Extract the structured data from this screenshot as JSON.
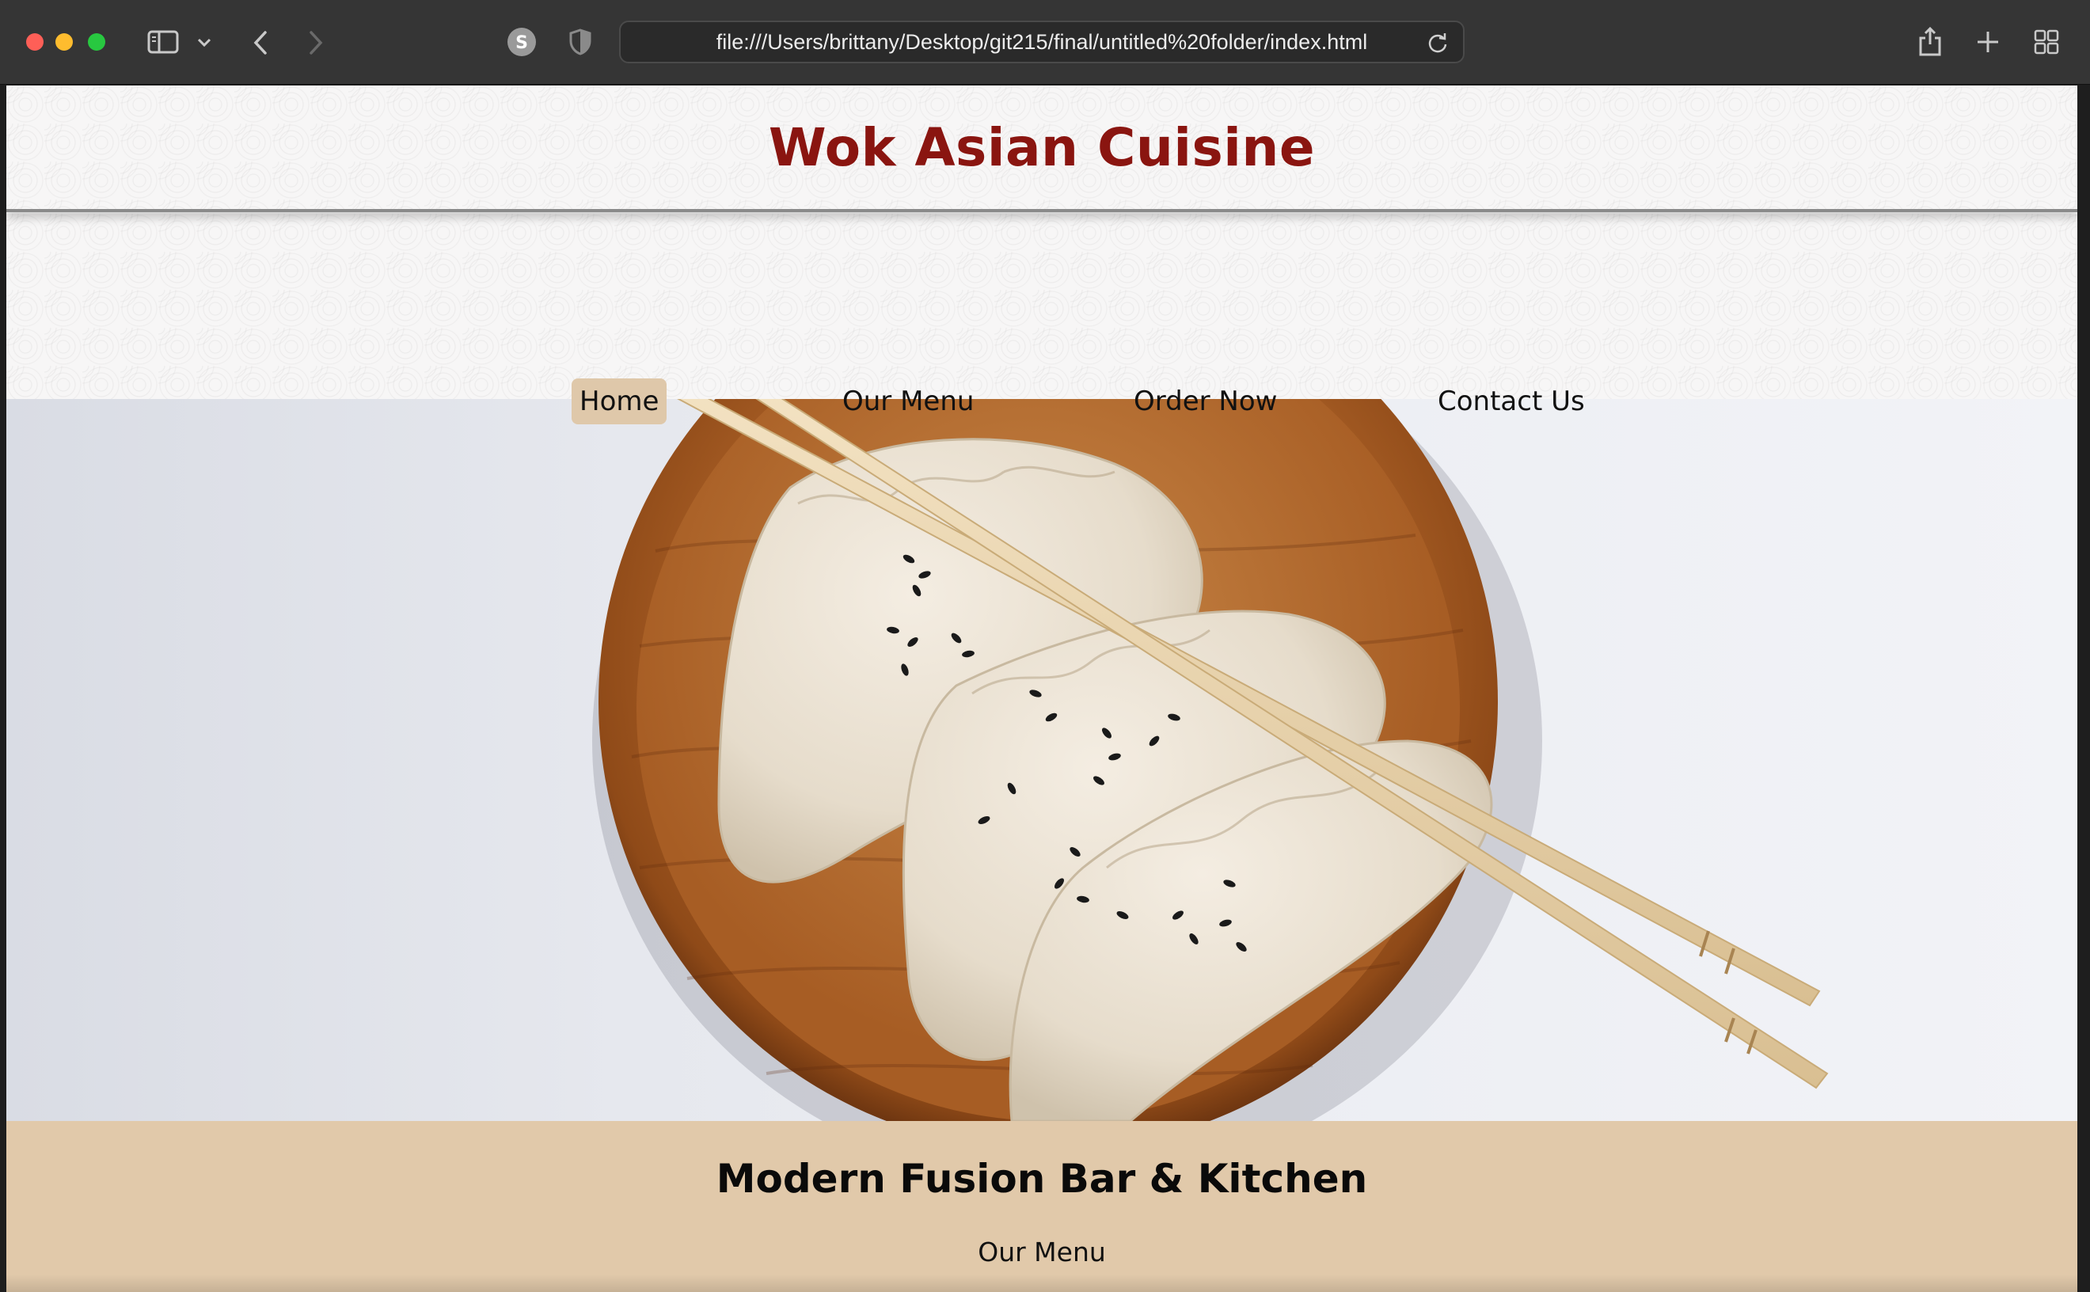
{
  "browser": {
    "url": "file:///Users/brittany/Desktop/git215/final/untitled%20folder/index.html",
    "icons": {
      "sidebar": "sidebar-icon",
      "dropdown": "chevron-down-icon",
      "back": "chevron-left-icon",
      "forward": "chevron-right-icon",
      "extension": "s-extension-icon",
      "privacy": "shield-icon",
      "reload": "reload-icon",
      "share": "share-icon",
      "new_tab": "plus-icon",
      "tab_overview": "grid-icon"
    }
  },
  "site": {
    "title": "Wok Asian Cuisine",
    "title_color": "#8a1510",
    "nav": [
      {
        "label": "Home",
        "active": true
      },
      {
        "label": "Our Menu",
        "active": false
      },
      {
        "label": "Order Now",
        "active": false
      },
      {
        "label": "Contact Us",
        "active": false
      }
    ],
    "hero_image": "dumplings-on-wooden-plate-with-chopsticks",
    "tagline": "Modern Fusion Bar & Kitchen",
    "section_link": "Our Menu",
    "accent_color": "#e1c9aa"
  }
}
